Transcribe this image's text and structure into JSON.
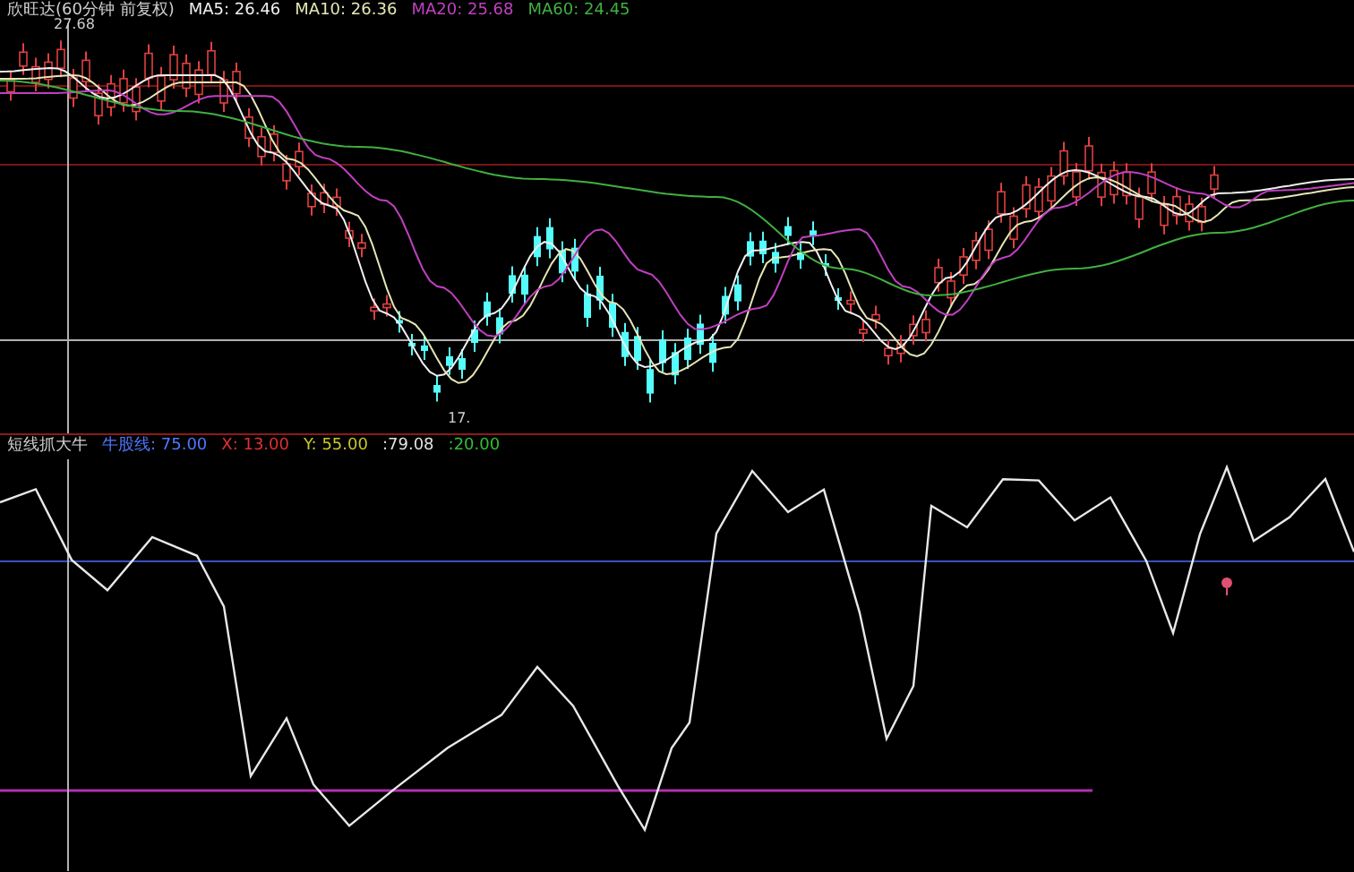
{
  "price_panel": {
    "title": "欣旺达(60分钟 前复权)",
    "moving_averages": [
      {
        "label": "MA5: 26.46",
        "color": "#f0f0f0"
      },
      {
        "label": "MA10: 26.36",
        "color": "#e6e6b4"
      },
      {
        "label": "MA20: 25.68",
        "color": "#c040c0"
      },
      {
        "label": "MA60: 24.45",
        "color": "#40b040"
      }
    ],
    "high_label": "27.68",
    "low_label": "17."
  },
  "indicator_panel": {
    "title": "短线抓大牛",
    "values": [
      {
        "label": "牛股线: 75.00",
        "color": "#5078ff"
      },
      {
        "label": "X: 13.00",
        "color": "#e03030"
      },
      {
        "label": "Y: 55.00",
        "color": "#c8c828"
      },
      {
        "label": ":79.08",
        "color": "#e0e0e0"
      },
      {
        "label": ":20.00",
        "color": "#30c030"
      }
    ]
  }
}
